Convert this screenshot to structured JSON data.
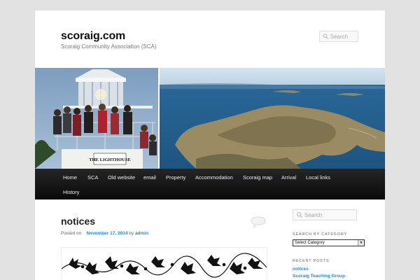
{
  "header": {
    "site_title": "scoraig.com",
    "site_description": "Scoraig Community Association (SCA)",
    "search_placeholder": "Search"
  },
  "banner": {
    "lighthouse_sign": "THE LIGHTHOUSE"
  },
  "nav": {
    "items": [
      "Home",
      "SCA",
      "Old website",
      "email",
      "Property",
      "Accommodation",
      "Scoraig map",
      "Arrival",
      "Local links",
      "History"
    ]
  },
  "post": {
    "title": "notices",
    "posted_on_label": "Posted on",
    "date": "November 17, 2014",
    "by_label": "by",
    "author": "admin"
  },
  "sidebar": {
    "search_placeholder": "Search",
    "category_heading": "SEARCH BY CATEGORY",
    "category_select_value": "Select Category",
    "recent_heading": "RECENT POSTS",
    "recent_posts": [
      "notices",
      "Scoraig Teaching Group"
    ]
  },
  "colors": {
    "background": "#e2e2e2",
    "link": "#1b8be0",
    "nav_background": "#1a1a1a"
  }
}
